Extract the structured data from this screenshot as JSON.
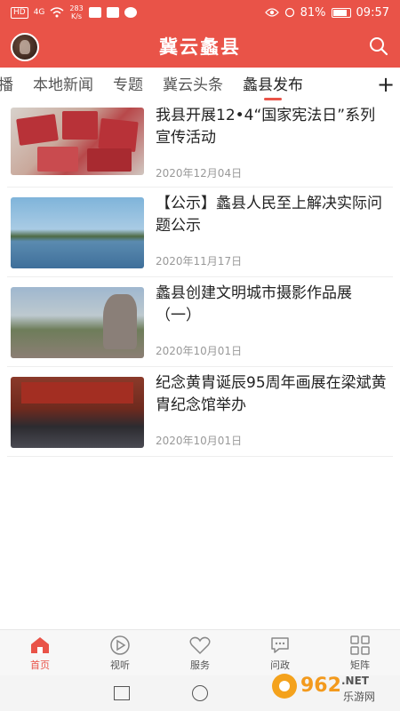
{
  "status_bar": {
    "network_badge": "HD",
    "signal_label": "4G",
    "speed_value": "283",
    "speed_unit": "K/s",
    "battery": "81%",
    "time": "09:57"
  },
  "header": {
    "title": "冀云蠡县"
  },
  "tabs": [
    {
      "label": "播",
      "active": false
    },
    {
      "label": "本地新闻",
      "active": false
    },
    {
      "label": "专题",
      "active": false
    },
    {
      "label": "冀云头条",
      "active": false
    },
    {
      "label": "蠡县发布",
      "active": true
    }
  ],
  "add_tab_label": "+",
  "news": [
    {
      "title": "我县开展12•4“国家宪法日”系列宣传活动",
      "date": "2020年12月04日"
    },
    {
      "title": "【公示】蠡县人民至上解决实际问题公示",
      "date": "2020年11月17日"
    },
    {
      "title": "蠡县创建文明城市摄影作品展（一）",
      "date": "2020年10月01日"
    },
    {
      "title": "纪念黄胄诞辰95周年画展在梁斌黄胄纪念馆举办",
      "date": "2020年10月01日"
    }
  ],
  "bottom_nav": [
    {
      "label": "首页",
      "icon": "home-icon",
      "active": true
    },
    {
      "label": "视听",
      "icon": "play-icon",
      "active": false
    },
    {
      "label": "服务",
      "icon": "heart-icon",
      "active": false
    },
    {
      "label": "问政",
      "icon": "chat-icon",
      "active": false
    },
    {
      "label": "矩阵",
      "icon": "grid-icon",
      "active": false
    }
  ],
  "watermark": {
    "number": "962",
    "domain": ".NET",
    "text": "乐游网"
  },
  "colors": {
    "brand": "#e95348",
    "text": "#222222",
    "date": "#999999"
  }
}
